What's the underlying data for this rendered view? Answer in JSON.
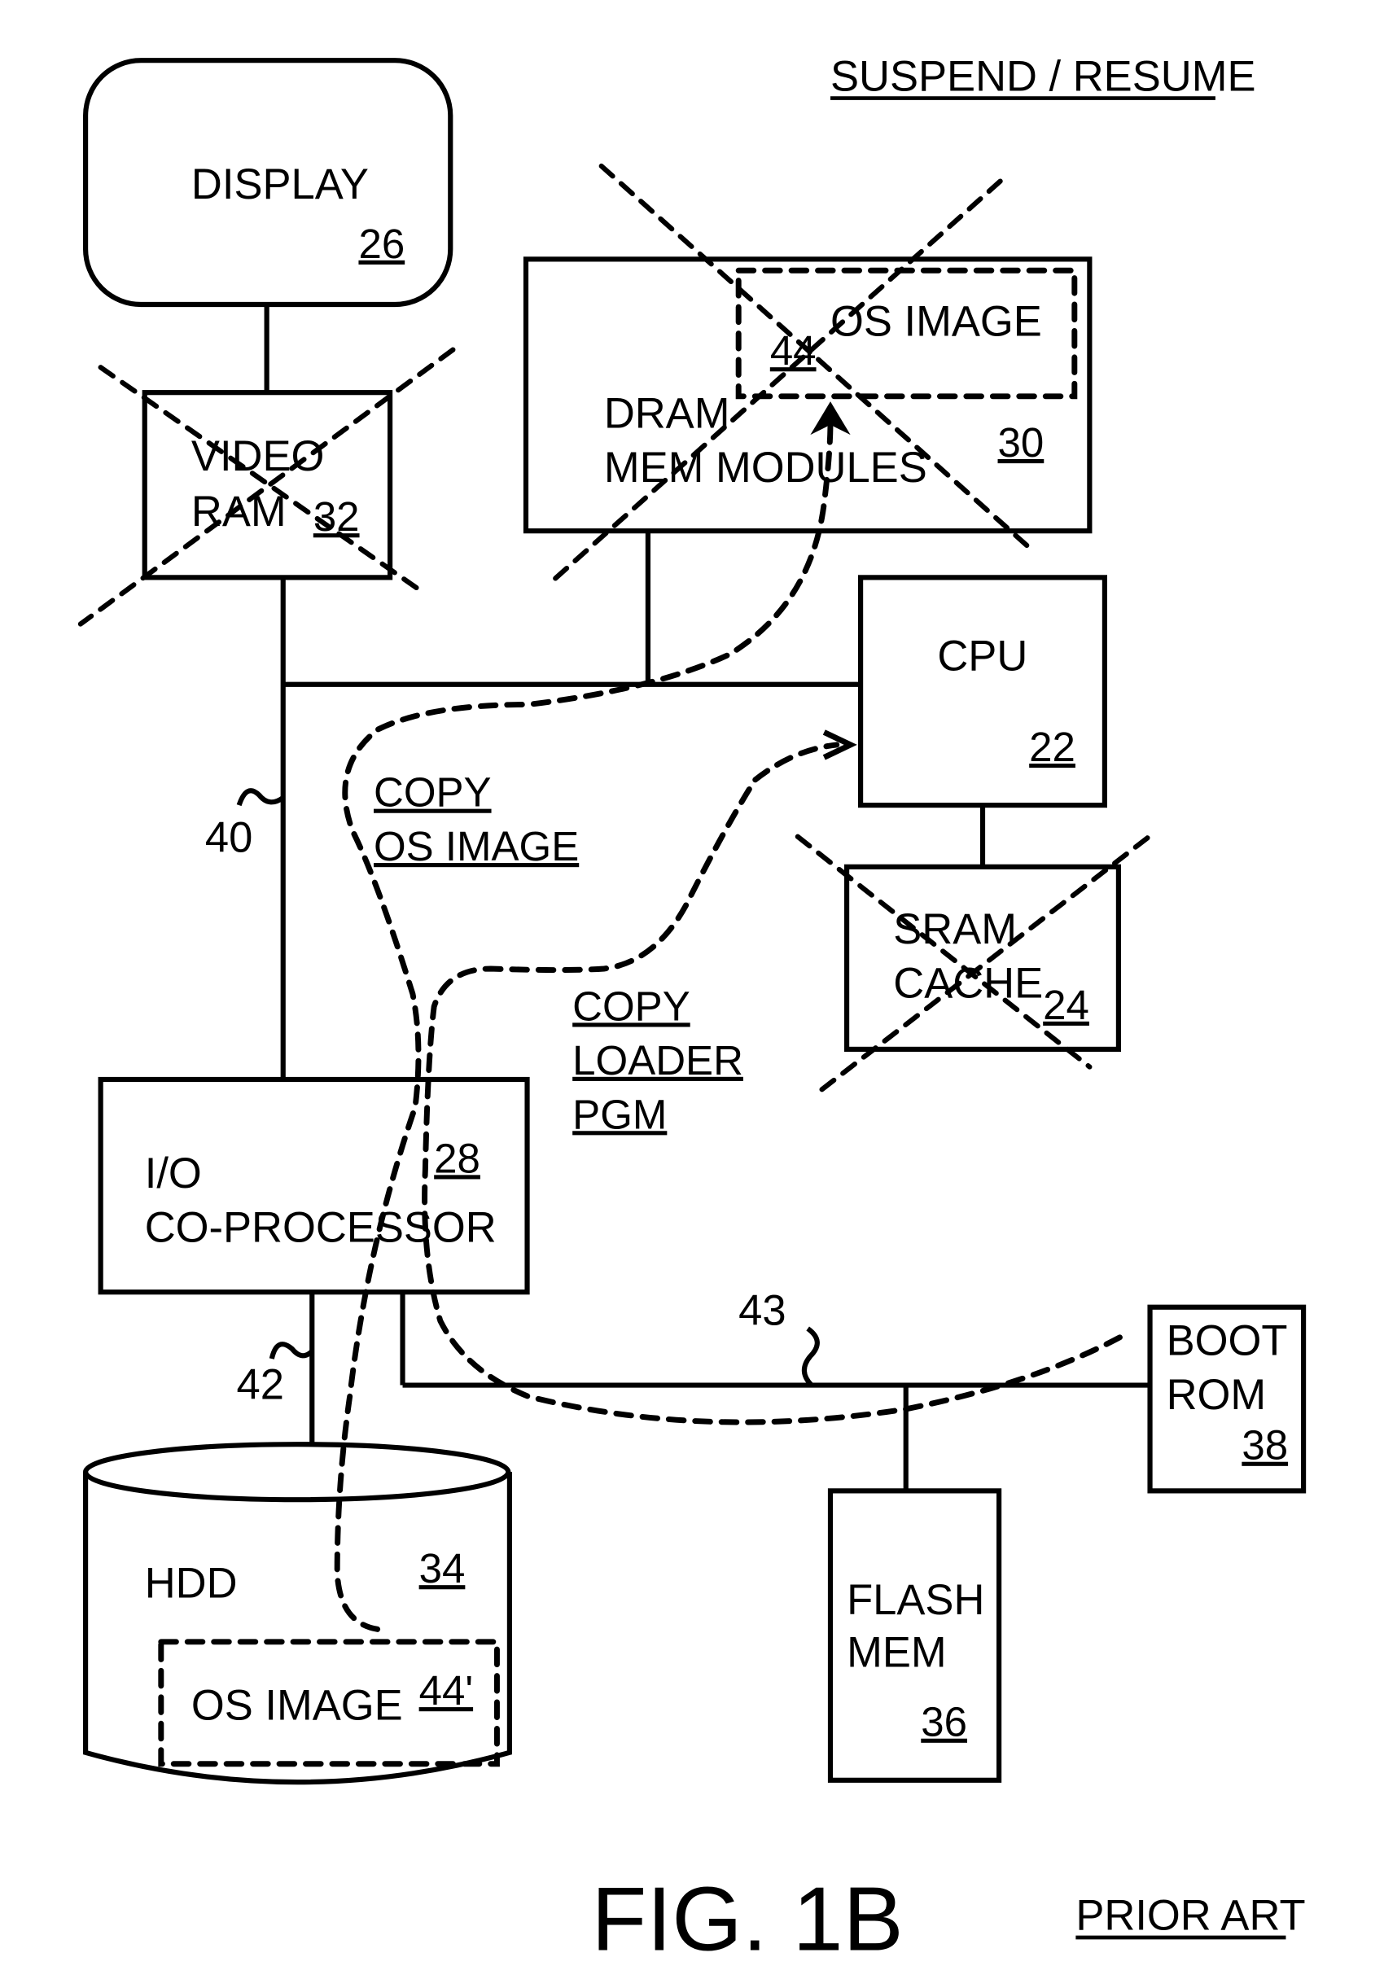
{
  "header": {
    "title": "SUSPEND / RESUME",
    "figure": "FIG. 1B",
    "note": "PRIOR ART"
  },
  "blocks": {
    "display": {
      "line1": "DISPLAY",
      "ref": "26",
      "disabled": false
    },
    "video_ram": {
      "line1": "VIDEO",
      "line2": "RAM",
      "ref": "32",
      "disabled": true
    },
    "dram": {
      "line1": "DRAM",
      "line2": "MEM MODULES",
      "ref": "30",
      "disabled": true
    },
    "dram_os_image": {
      "line1": "OS IMAGE",
      "ref": "44"
    },
    "cpu": {
      "line1": "CPU",
      "ref": "22",
      "disabled": false
    },
    "sram": {
      "line1": "SRAM",
      "line2": "CACHE",
      "ref": "24",
      "disabled": true
    },
    "io": {
      "line1": "I/O",
      "line2": "CO-PROCESSOR",
      "ref": "28"
    },
    "hdd": {
      "line1": "HDD",
      "ref": "34"
    },
    "hdd_os_image": {
      "line1": "OS IMAGE",
      "ref": "44'"
    },
    "flash": {
      "line1": "FLASH",
      "line2": "MEM",
      "ref": "36"
    },
    "boot_rom": {
      "line1": "BOOT",
      "line2": "ROM",
      "ref": "38"
    }
  },
  "buses": {
    "main_bus_ref": "40",
    "hdd_bus_ref": "42",
    "rom_bus_ref": "43"
  },
  "flows": {
    "copy_os_image": {
      "line1": "COPY",
      "line2": "OS IMAGE"
    },
    "copy_loader": {
      "line1": "COPY",
      "line2": "LOADER",
      "line3": "PGM"
    }
  }
}
